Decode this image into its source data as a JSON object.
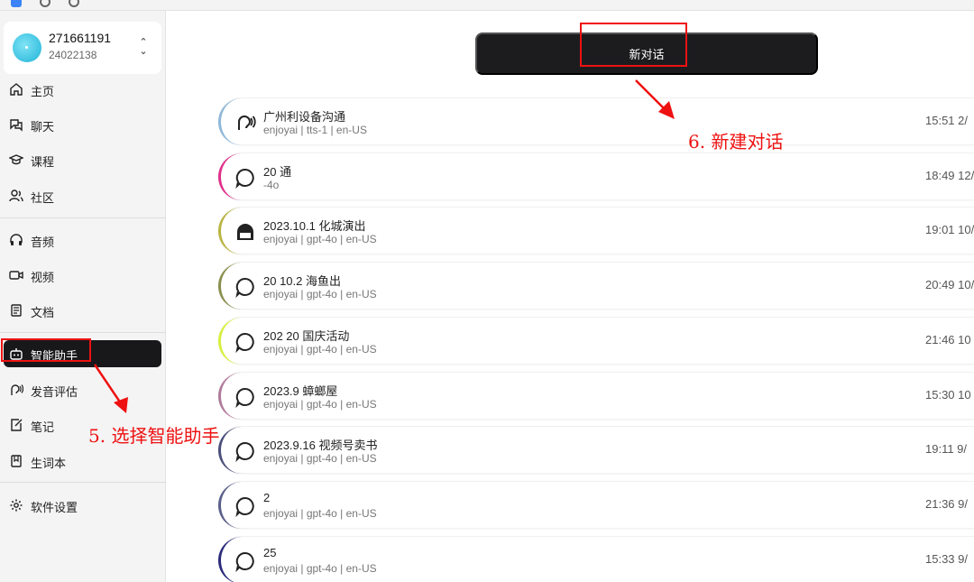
{
  "account": {
    "name": "271661191",
    "id": "24022138"
  },
  "sidebar": {
    "groups": [
      [
        {
          "label": "主页",
          "icon": "home-icon"
        },
        {
          "label": "聊天",
          "icon": "chat-icon"
        },
        {
          "label": "课程",
          "icon": "graduation-cap-icon"
        },
        {
          "label": "社区",
          "icon": "users-icon"
        }
      ],
      [
        {
          "label": "音频",
          "icon": "headphones-icon"
        },
        {
          "label": "视频",
          "icon": "video-icon"
        },
        {
          "label": "文档",
          "icon": "document-icon"
        }
      ],
      [
        {
          "label": "智能助手",
          "icon": "bot-icon",
          "active": true
        },
        {
          "label": "发音评估",
          "icon": "speech-icon"
        },
        {
          "label": "笔记",
          "icon": "note-icon"
        },
        {
          "label": "生词本",
          "icon": "book-icon"
        }
      ],
      [
        {
          "label": "软件设置",
          "icon": "gear-icon"
        }
      ]
    ]
  },
  "main": {
    "new_chat_label": "新对话",
    "chats": [
      {
        "title": "广州利设备沟通",
        "subtitle": "enjoyai | tts-1 | en-US",
        "time": "15:51 2/",
        "icon": "speech-icon",
        "color": "#8fb8d9"
      },
      {
        "title": "20 通",
        "subtitle": "-4o",
        "time": "18:49 12/",
        "icon": "message-icon",
        "color": "#e0308a"
      },
      {
        "title": "2023.10.1 化城演出",
        "subtitle": "enjoyai | gpt-4o | en-US",
        "time": "19:01 10/",
        "icon": "bot-icon",
        "color": "#b8b440"
      },
      {
        "title": "20 10.2 海鱼出",
        "subtitle": "enjoyai | gpt-4o | en-US",
        "time": "20:49 10/",
        "icon": "message-icon",
        "color": "#8a8f4e"
      },
      {
        "title": "202 20 国庆活动",
        "subtitle": "enjoyai | gpt-4o | en-US",
        "time": "21:46 10",
        "icon": "message-icon",
        "color": "#d8ef3c"
      },
      {
        "title": "2023.9 蟑螂屋",
        "subtitle": "enjoyai | gpt-4o | en-US",
        "time": "15:30 10",
        "icon": "message-icon",
        "color": "#b07a9a"
      },
      {
        "title": "2023.9.16 视频号卖书",
        "subtitle": "enjoyai | gpt-4o | en-US",
        "time": "19:11 9/",
        "icon": "message-icon",
        "color": "#4a4e7a"
      },
      {
        "title": "2",
        "subtitle": "enjoyai | gpt-4o | en-US",
        "time": "21:36 9/",
        "icon": "message-icon",
        "color": "#5a5f8a"
      },
      {
        "title": "25",
        "subtitle": "enjoyai | gpt-4o | en-US",
        "time": "15:33 9/",
        "icon": "message-icon",
        "color": "#2a2a7a"
      }
    ]
  },
  "annotations": {
    "step5": "5. 选择智能助手",
    "step6": "6. 新建对话",
    "color": "#e11111"
  }
}
